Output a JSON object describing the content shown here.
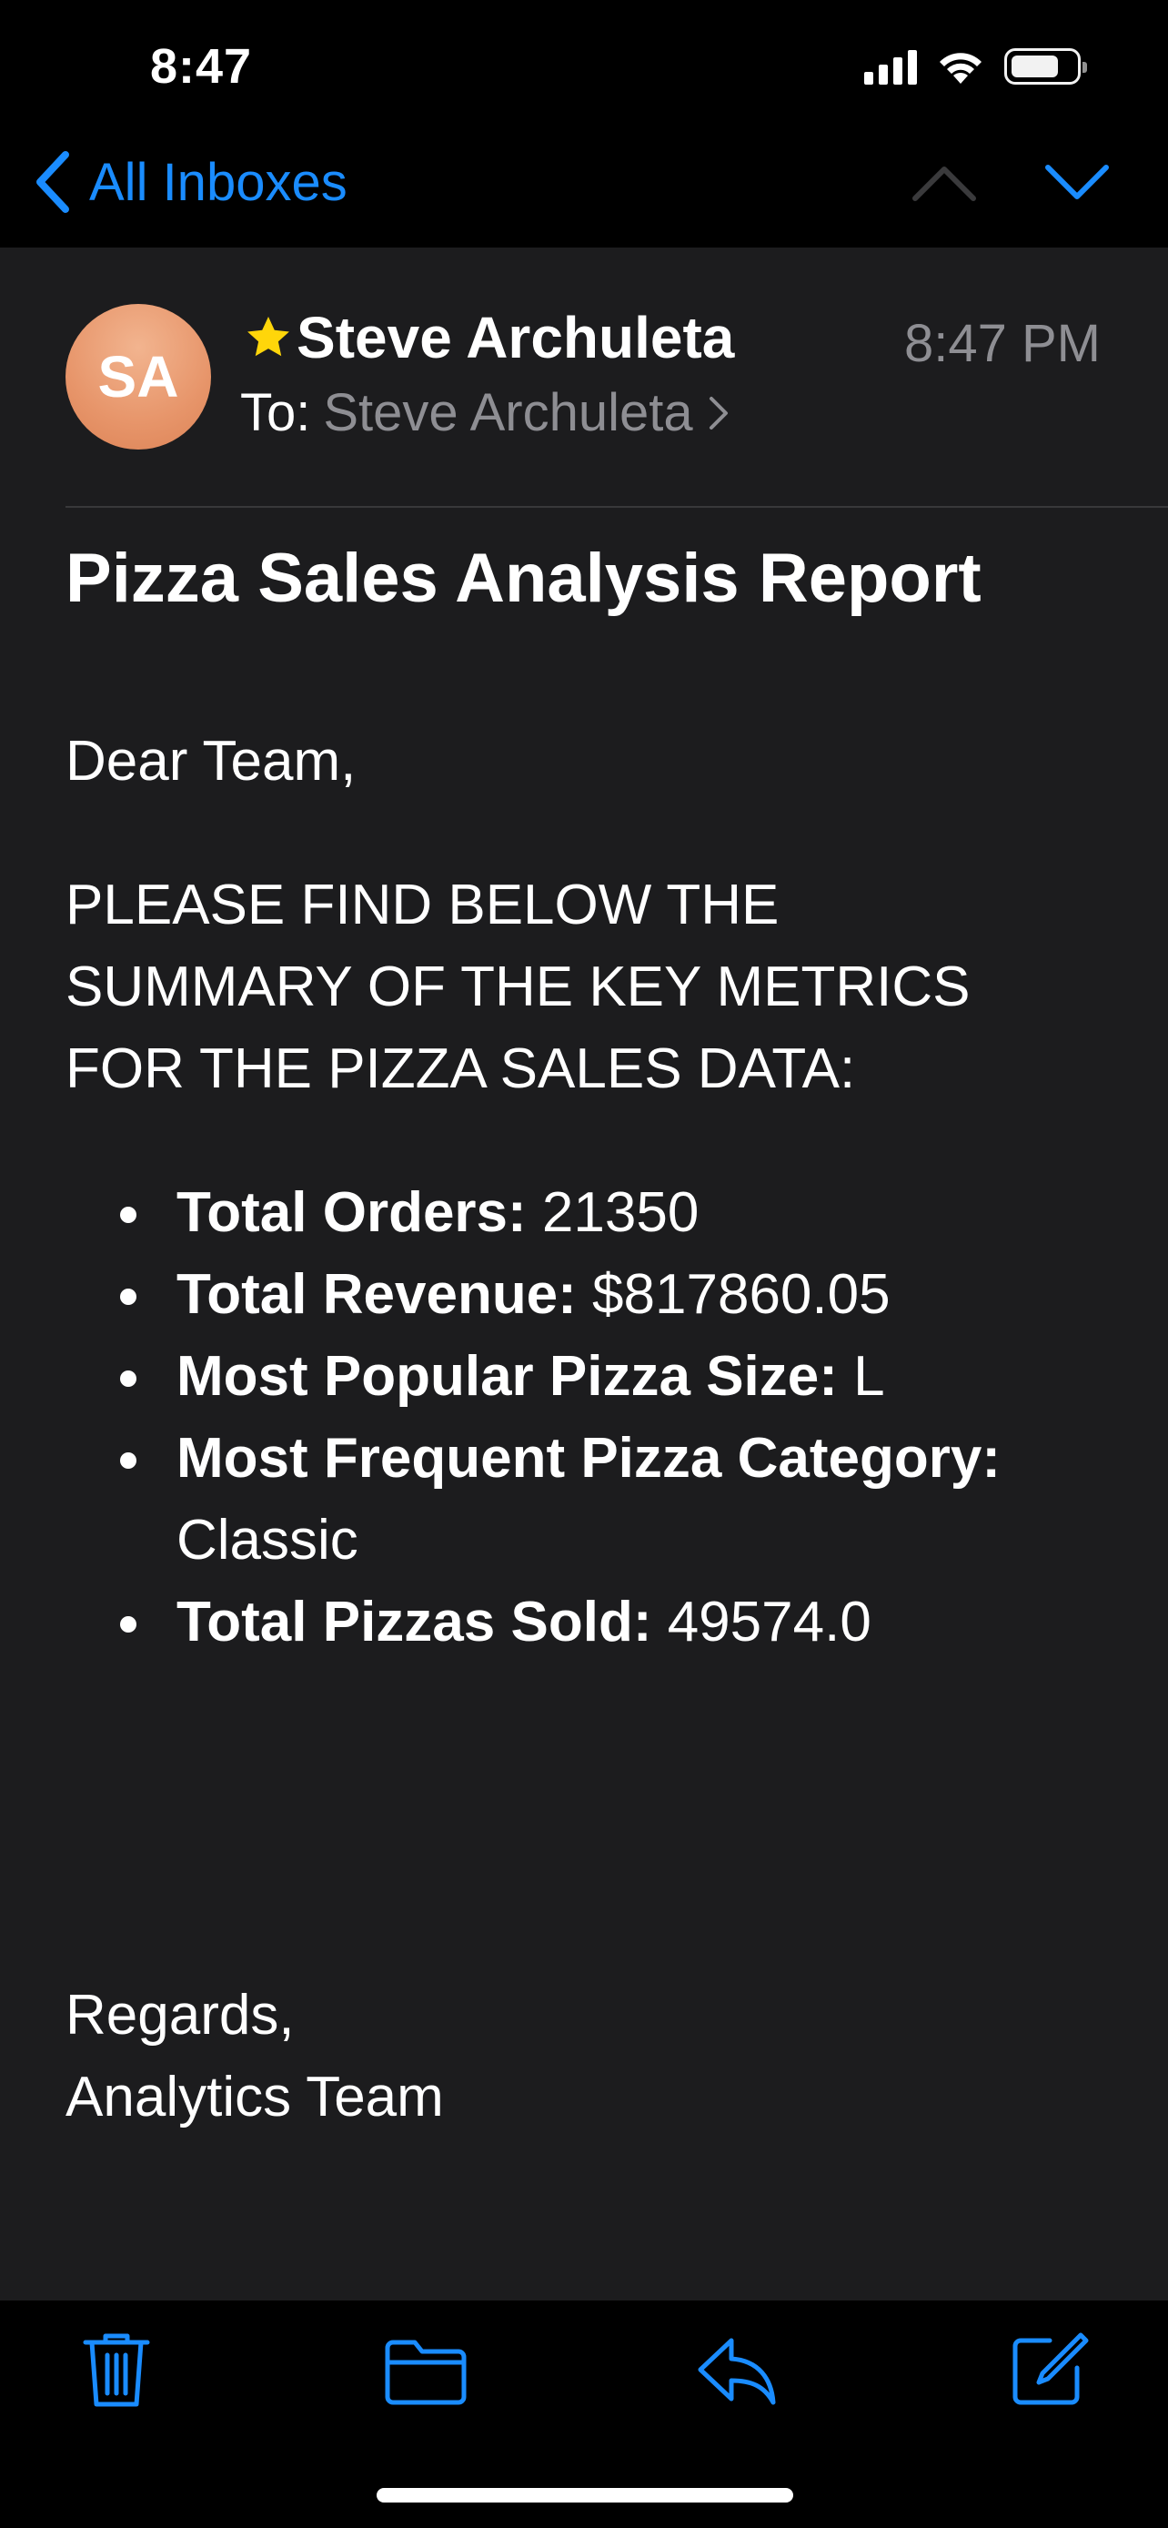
{
  "status_bar": {
    "time": "8:47",
    "battery_level": 0.75,
    "signal_bars": 4
  },
  "nav": {
    "back_label": "All Inboxes",
    "icons": [
      "chevron-left-icon",
      "chevron-up-icon",
      "chevron-down-icon"
    ],
    "accent_color": "#1a8cff"
  },
  "message": {
    "avatar_initials": "SA",
    "sender": "Steve Archuleta",
    "starred": true,
    "time": "8:47 PM",
    "to_label": "To:",
    "recipient": "Steve Archuleta",
    "subject": "Pizza Sales Analysis Report",
    "greeting": "Dear Team,",
    "intro": "PLEASE FIND BELOW THE SUMMARY OF THE KEY METRICS FOR THE PIZZA SALES DATA:",
    "metrics": [
      {
        "label": "Total Orders:",
        "value": "21350"
      },
      {
        "label": "Total Revenue:",
        "value": "$817860.05"
      },
      {
        "label": "Most Popular Pizza Size:",
        "value": "L"
      },
      {
        "label": "Most Frequent Pizza Category:",
        "value": "Classic"
      },
      {
        "label": "Total Pizzas Sold:",
        "value": "49574.0"
      }
    ],
    "closing": "Regards,",
    "signature": "Analytics Team"
  },
  "toolbar": {
    "icons": [
      "trash-icon",
      "folder-icon",
      "reply-icon",
      "compose-icon"
    ]
  },
  "colors": {
    "background": "#1c1c1e",
    "secondary_text": "#8e8e93",
    "star": "#ffd60a"
  }
}
